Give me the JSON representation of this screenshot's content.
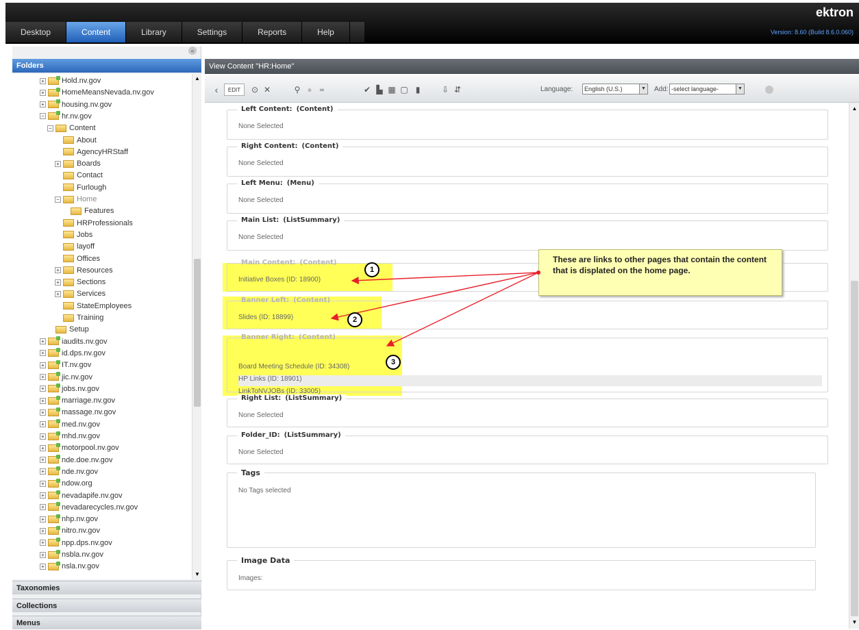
{
  "topbar": {
    "tabs": [
      "Desktop",
      "Content",
      "Library",
      "Settings",
      "Reports",
      "Help"
    ],
    "active_tab": "Content",
    "brand": "ektron",
    "version": "Version: 8.60 (Build 8.6.0.060)"
  },
  "left": {
    "folders_header": "Folders",
    "tree": [
      {
        "label": "Hold.nv.gov",
        "pm": "+",
        "kind": "site"
      },
      {
        "label": "HomeMeansNevada.nv.gov",
        "pm": "+",
        "kind": "site"
      },
      {
        "label": "housing.nv.gov",
        "pm": "+",
        "kind": "site"
      },
      {
        "label": "hr.nv.gov",
        "pm": "-",
        "kind": "site"
      },
      {
        "label": "Content",
        "pm": "-",
        "kind": "folder"
      },
      {
        "label": "About",
        "pm": "",
        "kind": "folder"
      },
      {
        "label": "AgencyHRStaff",
        "pm": "",
        "kind": "folder"
      },
      {
        "label": "Boards",
        "pm": "+",
        "kind": "folder"
      },
      {
        "label": "Contact",
        "pm": "",
        "kind": "folder"
      },
      {
        "label": "Furlough",
        "pm": "",
        "kind": "folder"
      },
      {
        "label": "Home",
        "pm": "-",
        "kind": "folder",
        "selected": true
      },
      {
        "label": "Features",
        "pm": "",
        "kind": "folder"
      },
      {
        "label": "HRProfessionals",
        "pm": "",
        "kind": "folder"
      },
      {
        "label": "Jobs",
        "pm": "",
        "kind": "folder"
      },
      {
        "label": "layoff",
        "pm": "",
        "kind": "folder"
      },
      {
        "label": "Offices",
        "pm": "",
        "kind": "folder"
      },
      {
        "label": "Resources",
        "pm": "+",
        "kind": "folder"
      },
      {
        "label": "Sections",
        "pm": "+",
        "kind": "folder"
      },
      {
        "label": "Services",
        "pm": "+",
        "kind": "folder"
      },
      {
        "label": "StateEmployees",
        "pm": "",
        "kind": "folder"
      },
      {
        "label": "Training",
        "pm": "",
        "kind": "folder"
      },
      {
        "label": "Setup",
        "pm": "",
        "kind": "folder"
      },
      {
        "label": "iaudits.nv.gov",
        "pm": "+",
        "kind": "site"
      },
      {
        "label": "id.dps.nv.gov",
        "pm": "+",
        "kind": "site"
      },
      {
        "label": "IT.nv.gov",
        "pm": "+",
        "kind": "site"
      },
      {
        "label": "jic.nv.gov",
        "pm": "+",
        "kind": "site"
      },
      {
        "label": "jobs.nv.gov",
        "pm": "+",
        "kind": "site"
      },
      {
        "label": "marriage.nv.gov",
        "pm": "+",
        "kind": "site"
      },
      {
        "label": "massage.nv.gov",
        "pm": "+",
        "kind": "site"
      },
      {
        "label": "med.nv.gov",
        "pm": "+",
        "kind": "site"
      },
      {
        "label": "mhd.nv.gov",
        "pm": "+",
        "kind": "site"
      },
      {
        "label": "motorpool.nv.gov",
        "pm": "+",
        "kind": "site"
      },
      {
        "label": "nde.doe.nv.gov",
        "pm": "+",
        "kind": "site"
      },
      {
        "label": "nde.nv.gov",
        "pm": "+",
        "kind": "site"
      },
      {
        "label": "ndow.org",
        "pm": "+",
        "kind": "site"
      },
      {
        "label": "nevadapife.nv.gov",
        "pm": "+",
        "kind": "site"
      },
      {
        "label": "nevadarecycles.nv.gov",
        "pm": "+",
        "kind": "site"
      },
      {
        "label": "nhp.nv.gov",
        "pm": "+",
        "kind": "site"
      },
      {
        "label": "nitro.nv.gov",
        "pm": "+",
        "kind": "site"
      },
      {
        "label": "npp.dps.nv.gov",
        "pm": "+",
        "kind": "site"
      },
      {
        "label": "nsbla.nv.gov",
        "pm": "+",
        "kind": "site"
      },
      {
        "label": "nsla.nv.gov",
        "pm": "+",
        "kind": "site"
      }
    ],
    "accordions": [
      "Taxonomies",
      "Collections",
      "Menus"
    ]
  },
  "right": {
    "view_header": "View Content \"HR:Home\"",
    "toolbar": {
      "edit": "EDIT",
      "language_label": "Language:",
      "language_value": "English (U.S.)",
      "add_label": "Add:",
      "add_value": "-select language-"
    },
    "sections": [
      {
        "title": "Left Content:",
        "type": "(Content)",
        "items": [
          "None Selected"
        ]
      },
      {
        "title": "Right Content:",
        "type": "(Content)",
        "items": [
          "None Selected"
        ]
      },
      {
        "title": "Left Menu:",
        "type": "(Menu)",
        "items": [
          "None Selected"
        ]
      },
      {
        "title": "Main List:",
        "type": "(ListSummary)",
        "items": [
          "None Selected"
        ]
      },
      {
        "title": "Main Content:",
        "type": "(Content)",
        "items": [
          "Initiative Boxes  (ID: 18900)"
        ]
      },
      {
        "title": "Banner Left:",
        "type": "(Content)",
        "items": [
          "Slides  (ID: 18899)"
        ]
      },
      {
        "title": "Banner Right:",
        "type": "(Content)",
        "items": [
          "Board Meeting Schedule  (ID: 34308)",
          "HP Links  (ID: 18901)",
          "LinkToNVJOBs  (ID: 33005)"
        ]
      },
      {
        "title": "Right List:",
        "type": "(ListSummary)",
        "items": [
          "None Selected"
        ]
      },
      {
        "title": "Folder_ID:",
        "type": "(ListSummary)",
        "items": [
          "None Selected"
        ]
      }
    ],
    "tags": {
      "title": "Tags",
      "value": "No Tags selected"
    },
    "image_data": {
      "title": "Image Data",
      "value": "Images:"
    }
  },
  "annotation": {
    "callout": "These are links to other pages that contain the content that is displated on the home page.",
    "numbers": [
      "1",
      "2",
      "3"
    ],
    "arrow_color": "#e8202a",
    "highlight_color": "#ffff3a"
  }
}
